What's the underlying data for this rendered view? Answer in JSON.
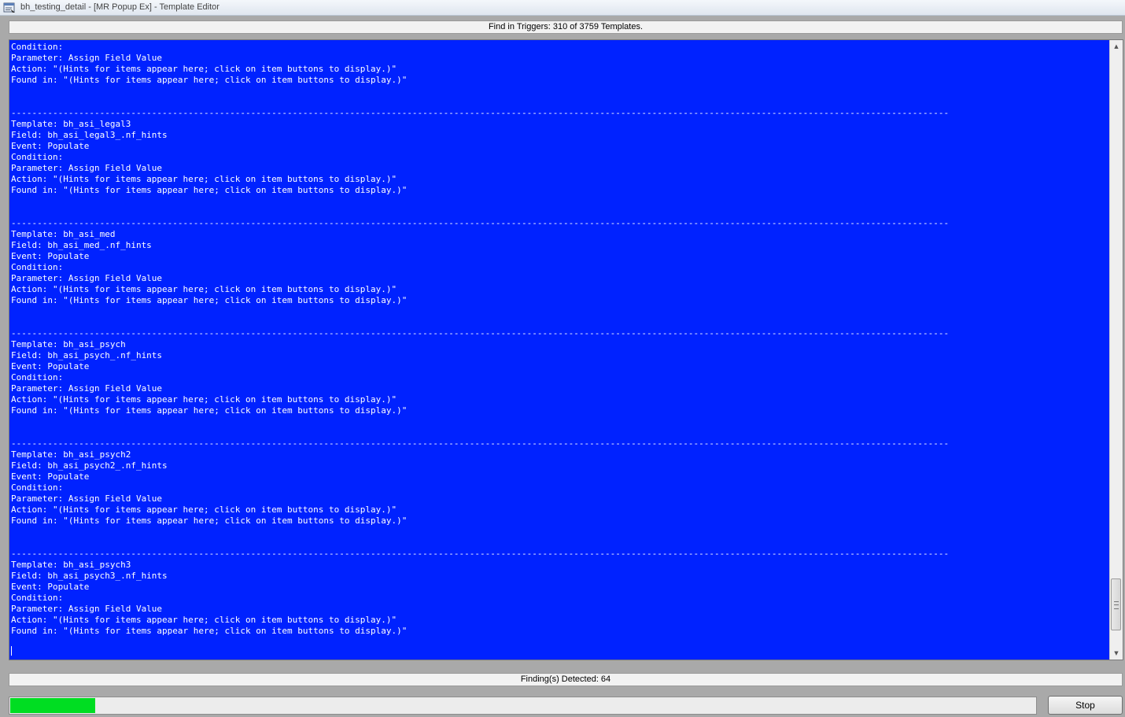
{
  "window": {
    "title": "bh_testing_detail - [MR Popup Ex] - Template Editor"
  },
  "find_bar": {
    "text": "Find in Triggers:  310 of 3759 Templates."
  },
  "results": {
    "text": "Condition:\nParameter: Assign Field Value\nAction: \"(Hints for items appear here; click on item buttons to display.)\"\nFound in: \"(Hints for items appear here; click on item buttons to display.)\"\n\n\n------------------------------------------------------------------------------------------------------------------------------------------------------------------------------------\nTemplate: bh_asi_legal3\nField: bh_asi_legal3_.nf_hints\nEvent: Populate\nCondition:\nParameter: Assign Field Value\nAction: \"(Hints for items appear here; click on item buttons to display.)\"\nFound in: \"(Hints for items appear here; click on item buttons to display.)\"\n\n\n------------------------------------------------------------------------------------------------------------------------------------------------------------------------------------\nTemplate: bh_asi_med\nField: bh_asi_med_.nf_hints\nEvent: Populate\nCondition:\nParameter: Assign Field Value\nAction: \"(Hints for items appear here; click on item buttons to display.)\"\nFound in: \"(Hints for items appear here; click on item buttons to display.)\"\n\n\n------------------------------------------------------------------------------------------------------------------------------------------------------------------------------------\nTemplate: bh_asi_psych\nField: bh_asi_psych_.nf_hints\nEvent: Populate\nCondition:\nParameter: Assign Field Value\nAction: \"(Hints for items appear here; click on item buttons to display.)\"\nFound in: \"(Hints for items appear here; click on item buttons to display.)\"\n\n\n------------------------------------------------------------------------------------------------------------------------------------------------------------------------------------\nTemplate: bh_asi_psych2\nField: bh_asi_psych2_.nf_hints\nEvent: Populate\nCondition:\nParameter: Assign Field Value\nAction: \"(Hints for items appear here; click on item buttons to display.)\"\nFound in: \"(Hints for items appear here; click on item buttons to display.)\"\n\n\n------------------------------------------------------------------------------------------------------------------------------------------------------------------------------------\nTemplate: bh_asi_psych3\nField: bh_asi_psych3_.nf_hints\nEvent: Populate\nCondition:\nParameter: Assign Field Value\nAction: \"(Hints for items appear here; click on item buttons to display.)\"\nFound in: \"(Hints for items appear here; click on item buttons to display.)\"\n",
    "scroll_position": 0.97,
    "text_color": "#ffffff",
    "background_color": "#0022ff"
  },
  "status_bar": {
    "text": "Finding(s) Detected: 64"
  },
  "progress": {
    "value": 0.083,
    "color": "#00dd22"
  },
  "stop_button": {
    "label": "Stop"
  },
  "icons": {
    "app": "template-editor-icon",
    "scroll_up": "scroll-up-arrow-icon",
    "scroll_down": "scroll-down-arrow-icon"
  }
}
